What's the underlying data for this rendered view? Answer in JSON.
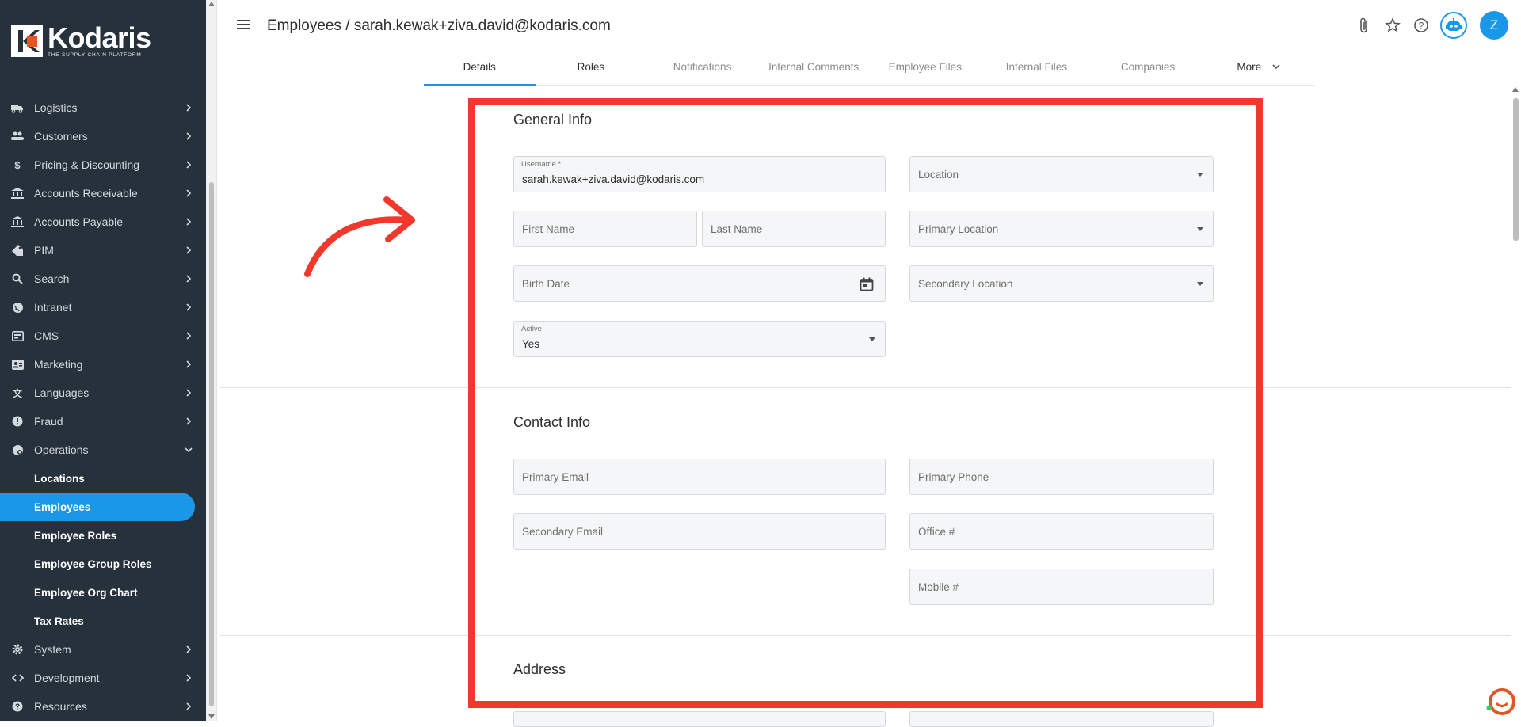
{
  "brand": {
    "name": "Kodaris",
    "tagline": "THE SUPPLY CHAIN PLATFORM"
  },
  "sidebar": {
    "items": [
      {
        "label": "Logistics",
        "icon": "truck-icon"
      },
      {
        "label": "Customers",
        "icon": "people-icon"
      },
      {
        "label": "Pricing & Discounting",
        "icon": "dollar-icon"
      },
      {
        "label": "Accounts Receivable",
        "icon": "bank-icon"
      },
      {
        "label": "Accounts Payable",
        "icon": "bank-icon"
      },
      {
        "label": "PIM",
        "icon": "tag-icon"
      },
      {
        "label": "Search",
        "icon": "search-icon"
      },
      {
        "label": "Intranet",
        "icon": "globe-icon"
      },
      {
        "label": "CMS",
        "icon": "cms-icon"
      },
      {
        "label": "Marketing",
        "icon": "badge-icon"
      },
      {
        "label": "Languages",
        "icon": "translate-icon"
      },
      {
        "label": "Fraud",
        "icon": "alert-icon"
      },
      {
        "label": "Operations",
        "icon": "operations-icon"
      }
    ],
    "operations_sub": [
      {
        "label": "Locations"
      },
      {
        "label": "Employees",
        "active": true
      },
      {
        "label": "Employee Roles"
      },
      {
        "label": "Employee Group Roles"
      },
      {
        "label": "Employee Org Chart"
      },
      {
        "label": "Tax Rates"
      }
    ],
    "bottom_items": [
      {
        "label": "System",
        "icon": "gear-icon"
      },
      {
        "label": "Development",
        "icon": "code-icon"
      },
      {
        "label": "Resources",
        "icon": "help-icon"
      }
    ]
  },
  "header": {
    "title": "Employees / sarah.kewak+ziva.david@kodaris.com",
    "avatar_initial": "Z"
  },
  "tabs": [
    "Details",
    "Roles",
    "Notifications",
    "Internal Comments",
    "Employee Files",
    "Internal Files",
    "Companies",
    "More"
  ],
  "general_info": {
    "title": "General Info",
    "username_label": "Username *",
    "username_value": "sarah.kewak+ziva.david@kodaris.com",
    "location": "Location",
    "first_name": "First Name",
    "last_name": "Last Name",
    "primary_location": "Primary Location",
    "birth_date": "Birth Date",
    "secondary_location": "Secondary Location",
    "active_label": "Active",
    "active_value": "Yes"
  },
  "contact_info": {
    "title": "Contact Info",
    "primary_email": "Primary Email",
    "primary_phone": "Primary Phone",
    "secondary_email": "Secondary Email",
    "office": "Office #",
    "mobile": "Mobile #"
  },
  "address": {
    "title": "Address"
  },
  "colors": {
    "accent": "#1a97e6",
    "sidebar": "#26313c",
    "annotation": "#f2372c"
  }
}
